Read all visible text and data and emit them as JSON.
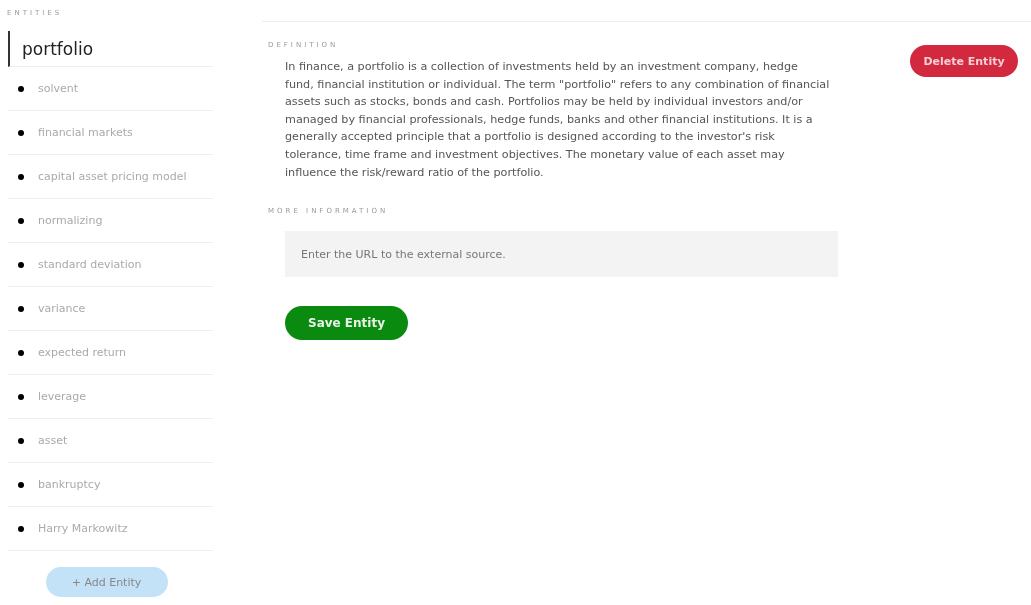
{
  "sidebar": {
    "heading": "ENTITIES",
    "items": [
      {
        "label": "portfolio",
        "selected": true
      },
      {
        "label": "solvent",
        "selected": false
      },
      {
        "label": "financial markets",
        "selected": false
      },
      {
        "label": "capital asset pricing model",
        "selected": false
      },
      {
        "label": "normalizing",
        "selected": false
      },
      {
        "label": "standard deviation",
        "selected": false
      },
      {
        "label": "variance",
        "selected": false
      },
      {
        "label": "expected return",
        "selected": false
      },
      {
        "label": "leverage",
        "selected": false
      },
      {
        "label": "asset",
        "selected": false
      },
      {
        "label": "bankruptcy",
        "selected": false
      },
      {
        "label": "Harry Markowitz",
        "selected": false
      }
    ],
    "add_button": "+ Add Entity"
  },
  "definition": {
    "heading": "DEFINITION",
    "text": "In finance, a portfolio is a collection of investments held by an investment company, hedge fund, financial institution or individual. The term \"portfolio\" refers to any combination of financial assets such as stocks, bonds and cash. Portfolios may be held by individual investors and/or managed by financial professionals, hedge funds, banks and other financial institutions. It is a generally accepted principle that a portfolio is designed according to the investor's risk tolerance, time frame and investment objectives. The monetary value of each asset may influence the risk/reward ratio of the portfolio."
  },
  "delete_button": "Delete Entity",
  "more_information": {
    "heading": "MORE INFORMATION",
    "placeholder": "Enter the URL to the external source."
  },
  "save_button": "Save Entity"
}
